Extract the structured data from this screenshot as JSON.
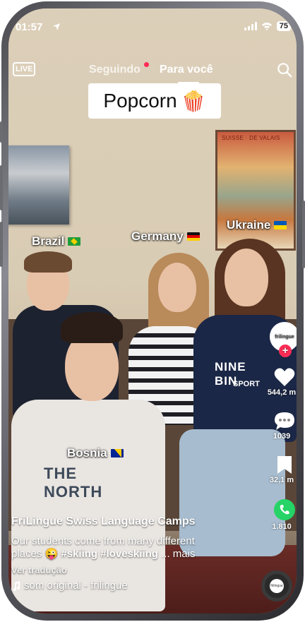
{
  "status": {
    "time": "01:57",
    "battery": "75"
  },
  "nav": {
    "live_label": "LIVE",
    "tab_following": "Seguindo",
    "tab_for_you": "Para você"
  },
  "overlay": {
    "popcorn_text": "Popcorn",
    "popcorn_emoji": "🍿"
  },
  "scene": {
    "poster_title": "SUISSE · DE VALAIS"
  },
  "tags": [
    {
      "name": "Brazil",
      "flag": "brazil-flag"
    },
    {
      "name": "Germany",
      "flag": "germany-flag"
    },
    {
      "name": "Ukraine",
      "flag": "ukraine-flag"
    },
    {
      "name": "Bosnia",
      "flag": "bosnia-flag"
    }
  ],
  "rail": {
    "avatar_text": "frilingue",
    "likes": "544,2 m",
    "comments": "1039",
    "saves": "32,1 m",
    "shares": "1.810"
  },
  "caption": {
    "author": "FriLingue Swiss Language Camps",
    "desc_text": "Our students come from many different places 😜 ",
    "hashtags": "#skiing #loveskiing",
    "more": " ... mais",
    "translate": "Ver tradução",
    "sound": "som original - frilingue"
  },
  "disc_text": "frilingue",
  "colors": {
    "accent": "#fe2c55",
    "whatsapp": "#25d366"
  }
}
